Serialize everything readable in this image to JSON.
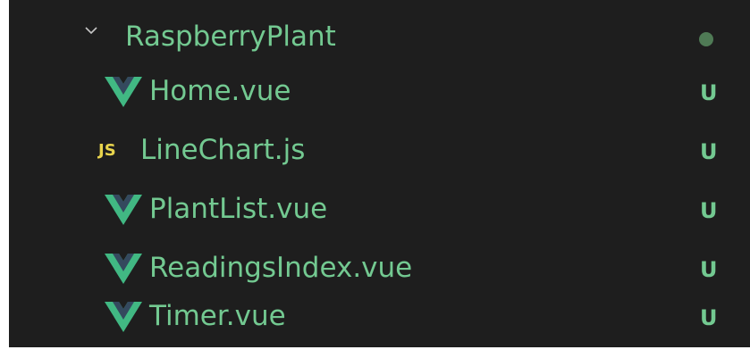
{
  "explorer": {
    "folder": {
      "name": "RaspberryPlant",
      "expanded": true,
      "icon": "chevron-down-icon",
      "status_color": "#4f7a55"
    },
    "files": [
      {
        "name": "Home.vue",
        "icon": "vue-icon",
        "status": "U"
      },
      {
        "name": "LineChart.js",
        "icon": "js-icon",
        "icon_text": "JS",
        "status": "U"
      },
      {
        "name": "PlantList.vue",
        "icon": "vue-icon",
        "status": "U"
      },
      {
        "name": "ReadingsIndex.vue",
        "icon": "vue-icon",
        "status": "U"
      },
      {
        "name": "Timer.vue",
        "icon": "vue-icon",
        "status": "U"
      }
    ],
    "colors": {
      "background": "#1e1e1e",
      "untracked_text": "#73c991",
      "vue_icon": "#41b883",
      "js_icon": "#e8d44d"
    }
  }
}
